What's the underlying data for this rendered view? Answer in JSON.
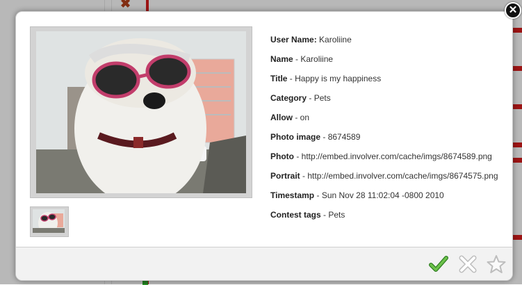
{
  "dialog": {
    "close_symbol": "✕",
    "fields": [
      {
        "label": "User Name:",
        "value": "Karoliine"
      },
      {
        "label": "Name",
        "value": "- Karoliine"
      },
      {
        "label": "Title",
        "value": "- Happy is my happiness"
      },
      {
        "label": "Category",
        "value": "- Pets"
      },
      {
        "label": "Allow",
        "value": "- on"
      },
      {
        "label": "Photo image",
        "value": "- 8674589"
      },
      {
        "label": "Photo",
        "value": "- http://embed.involver.com/cache/imgs/8674589.png"
      },
      {
        "label": "Portrait",
        "value": "- http://embed.involver.com/cache/imgs/8674575.png"
      },
      {
        "label": "Timestamp",
        "value": "- Sun Nov 28 11:02:04 -0800 2010"
      },
      {
        "label": "Contest tags",
        "value": "- Pets"
      }
    ]
  },
  "footer": {
    "approve_icon": "checkmark-icon",
    "reject_icon": "x-outline-icon",
    "favorite_icon": "star-outline-icon",
    "approve_color": "#4caf3b",
    "inactive_color": "#d0d0d0"
  }
}
